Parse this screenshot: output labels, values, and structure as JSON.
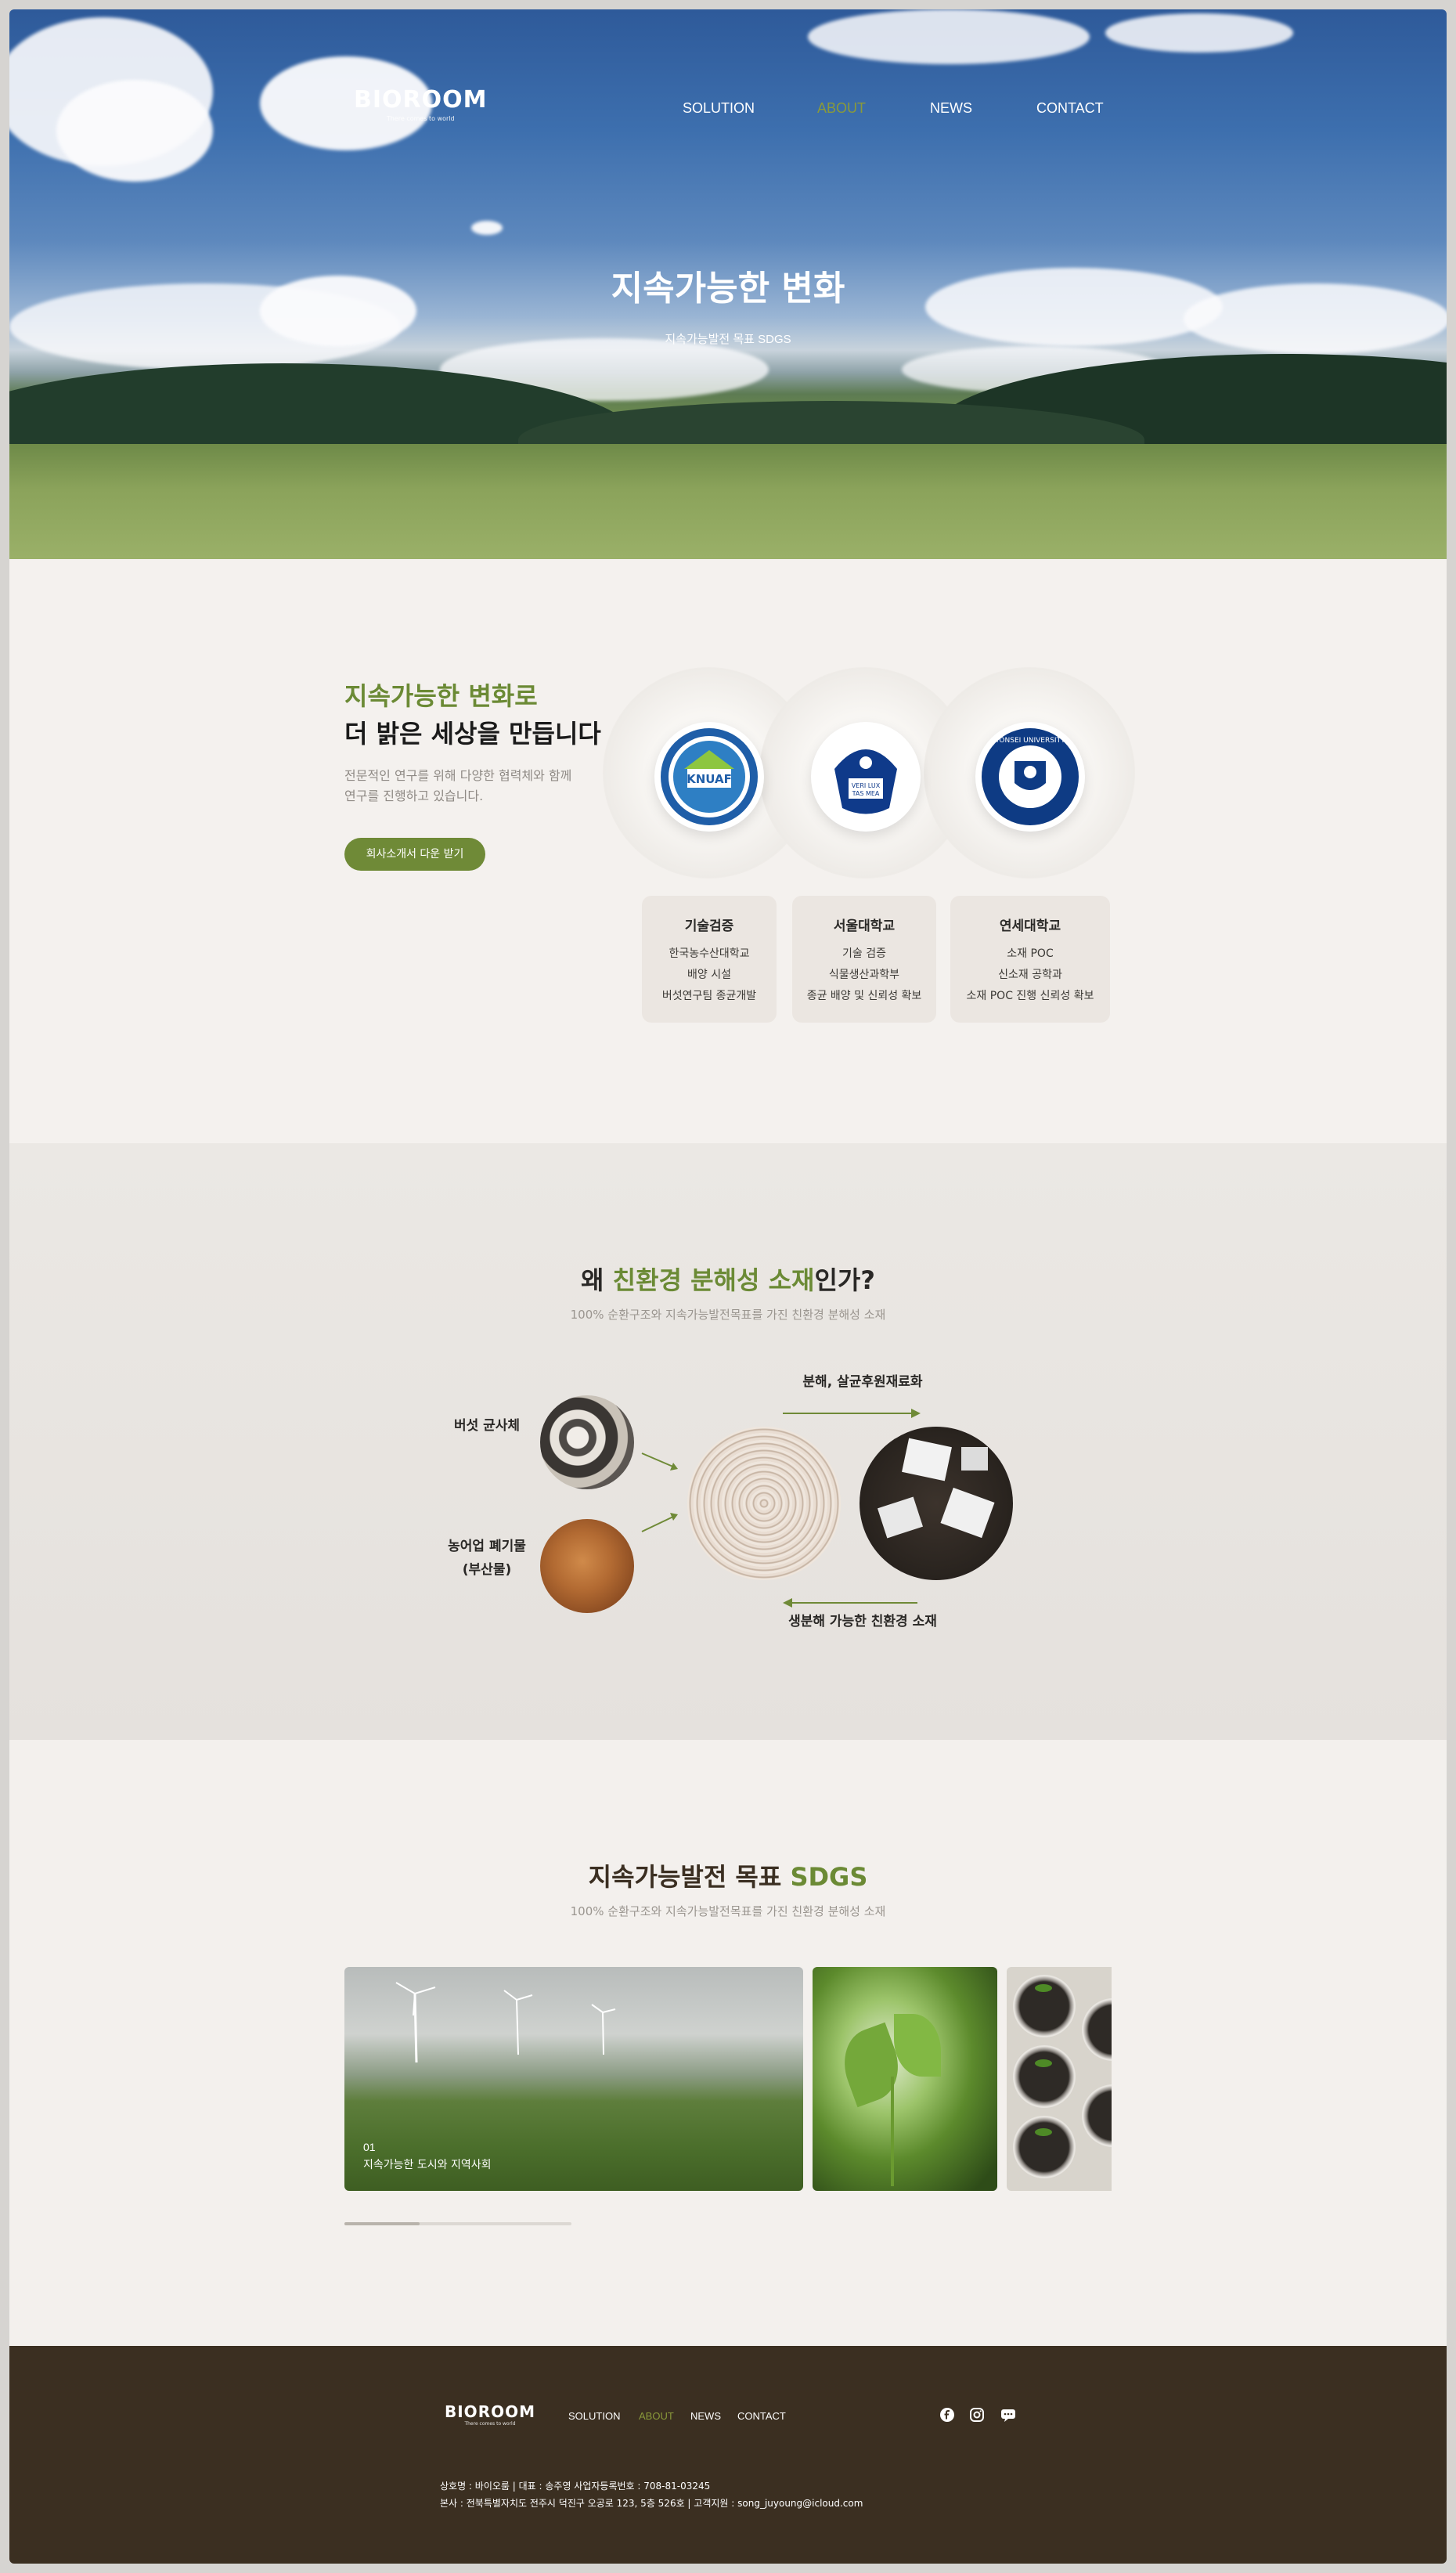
{
  "brand": {
    "name": "BIOROOM",
    "tagline": "There comes to world"
  },
  "nav": {
    "items": [
      "SOLUTION",
      "ABOUT",
      "NEWS",
      "CONTACT"
    ],
    "active": "ABOUT",
    "active_color": "#8a9a3a"
  },
  "hero": {
    "title": "지속가능한 변화",
    "subtitle": "지속가능발전 목표 SDGS"
  },
  "partners": {
    "heading_green": "지속가능한 변화로",
    "heading_dark": "더 밝은 세상을 만듭니다",
    "description": "전문적인 연구를 위해 다양한 협력체와 함께 연구를 진행하고 있습니다.",
    "button_label": "회사소개서 다운 받기",
    "logos": [
      {
        "name": "knuaf-logo-icon",
        "text": "KNUAF"
      },
      {
        "name": "snu-logo-icon",
        "text": "VERI TAS LUX MEA"
      },
      {
        "name": "yonsei-logo-icon",
        "text": "YONSEI UNIVERSITY"
      }
    ],
    "cards": [
      {
        "title": "기술검증",
        "lines": [
          "한국농수산대학교",
          "배양 시설",
          "버섯연구팀 종균개발"
        ]
      },
      {
        "title": "서울대학교",
        "lines": [
          "기술 검증",
          "식물생산과학부",
          "종균 배양 및 신뢰성 확보"
        ]
      },
      {
        "title": "연세대학교",
        "lines": [
          "소재 POC",
          "신소재 공학과",
          "소재 POC 진행 신뢰성 확보"
        ]
      }
    ]
  },
  "why": {
    "title_pre": "왜 ",
    "title_green": "친환경 분해성 소재",
    "title_post": "인가?",
    "subtitle": "100% 순환구조와 지속가능발전목표를 가진 친환경 분해성 소재",
    "label_mushroom": "버섯 균사체",
    "label_agri_1": "농어업 폐기물",
    "label_agri_2": "(부산물)",
    "label_decompose": "분해, 살균후원재료화",
    "label_biodegradable": "생분해 가능한 친환경 소재"
  },
  "sdgs": {
    "title_pre": "지속가능발전 목표 ",
    "title_green": "SDGS",
    "subtitle": "100% 순환구조와 지속가능발전목표를 가진 친환경 분해성 소재",
    "slides": [
      {
        "number": "01",
        "caption": "지속가능한 도시와 지역사회"
      }
    ],
    "progress": 0.33
  },
  "footer": {
    "nav": [
      "SOLUTION",
      "ABOUT",
      "NEWS",
      "CONTACT"
    ],
    "social": [
      "facebook-icon",
      "instagram-icon",
      "chat-icon"
    ],
    "info_line1": "상호명 : 바이오룸 | 대표 : 송주영 사업자등록번호 : 708-81-03245",
    "info_line2": "본사 : 전북특별자치도 전주시 덕진구 오공로 123, 5층 526호 | 고객지원 : song_juyoung@icloud.com"
  },
  "colors": {
    "accent_green": "#6b8a35",
    "footer_brown": "#3b2f21"
  }
}
